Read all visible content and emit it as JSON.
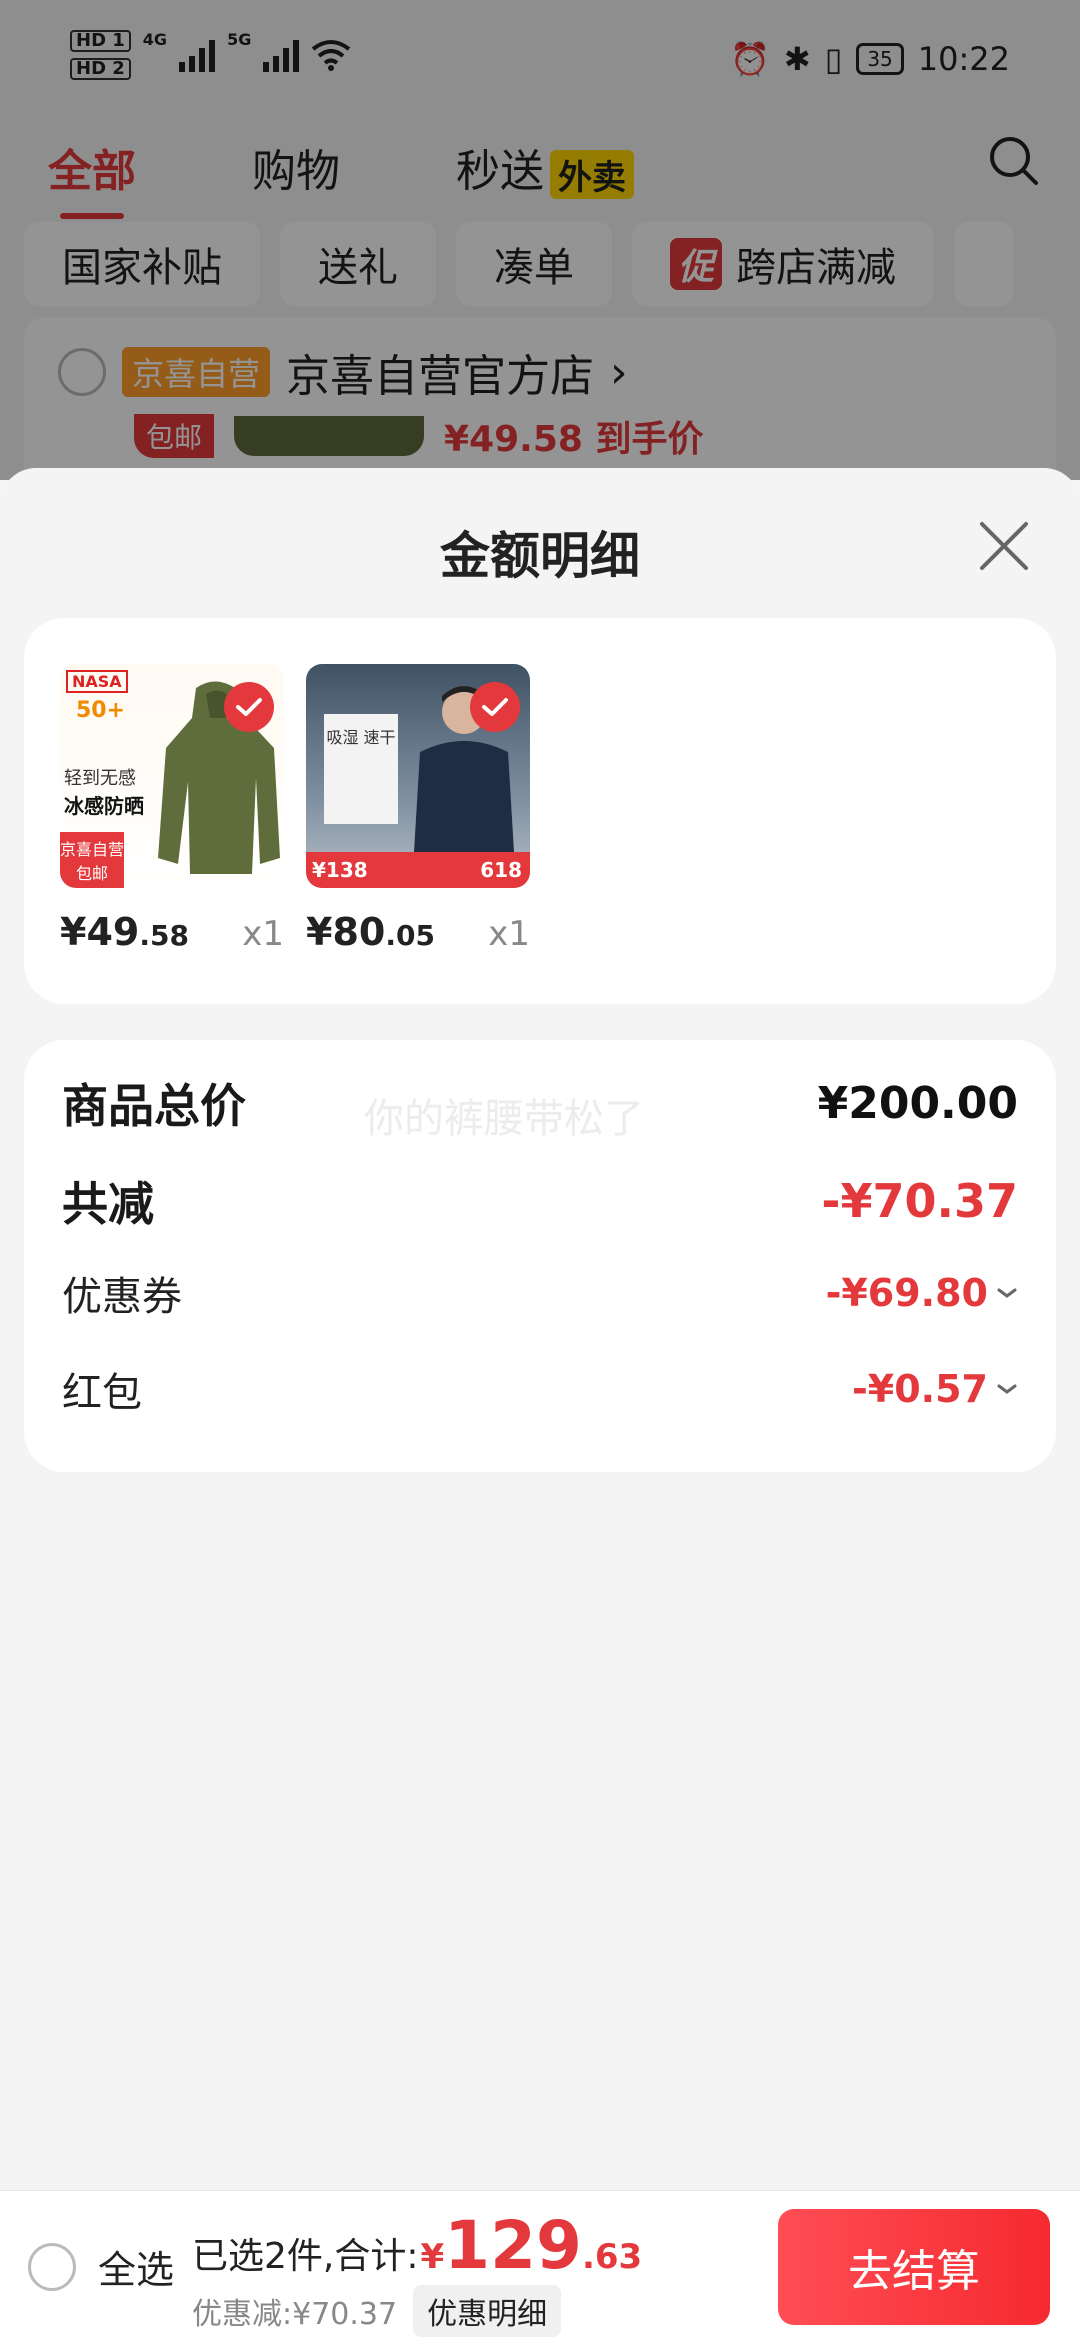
{
  "status_bar": {
    "sim1": "HD 1",
    "sim2": "HD 2",
    "net1": "4G",
    "net2": "5G",
    "battery": "35",
    "time": "10:22"
  },
  "top_tabs": [
    {
      "label": "全部",
      "active": true
    },
    {
      "label": "购物",
      "active": false
    },
    {
      "label": "秒送",
      "badge": "外卖",
      "active": false
    }
  ],
  "filters": [
    "国家补贴",
    "送礼",
    "凑单",
    "跨店满减"
  ],
  "filter_promo_badge": "促",
  "store": {
    "tag": "京喜自营",
    "name": "京喜自营官方店",
    "chevron": "›",
    "peek_tag": "包邮",
    "peek_price": "¥49.58 到手价"
  },
  "sheet": {
    "title": "金额明细",
    "items": [
      {
        "price_int": "¥49",
        "price_dec": ".58",
        "qty": "x1",
        "img": {
          "brand": "NASA",
          "upf": "50+",
          "line1": "轻到无感",
          "line2": "冰感防晒",
          "tag": "京喜自营 包邮"
        }
      },
      {
        "price_int": "¥80",
        "price_dec": ".05",
        "qty": "x1",
        "img": {
          "panel": "吸湿 速干",
          "price": "¥138",
          "sale": "618"
        }
      }
    ],
    "watermark": "你的裤腰带松了",
    "rows": {
      "total_label": "商品总价",
      "total_value": "¥200.00",
      "reduce_label": "共减",
      "reduce_value": "-¥70.37",
      "coupon_label": "优惠券",
      "coupon_value": "-¥69.80",
      "redpack_label": "红包",
      "redpack_value": "-¥0.57"
    }
  },
  "bottom_bar": {
    "select_all": "全选",
    "selected_text": "已选2件,合计:",
    "currency": "¥",
    "total_int": "129",
    "total_dec": ".63",
    "discount_text": "优惠减:¥70.37",
    "detail_label": "优惠明细",
    "checkout_label": "去结算"
  },
  "colors": {
    "accent": "#e4393c",
    "checkout": "#f52a2f",
    "sheet_bg": "#f4f4f4"
  }
}
